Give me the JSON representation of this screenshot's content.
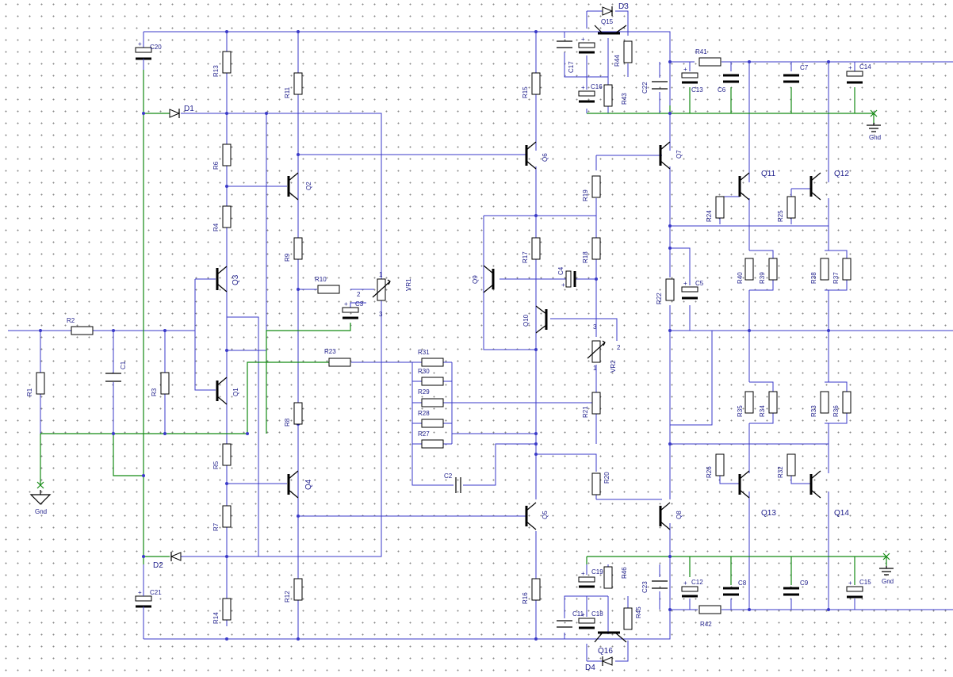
{
  "colors": {
    "wire": "#3a3ac8",
    "ground_rail": "#138a13",
    "component": "#000000",
    "label": "#1d1d8a",
    "grid_dot": "#8a8a8a"
  },
  "resistors": {
    "R1": "R1",
    "R2": "R2",
    "R3": "R3",
    "R4": "R4",
    "R5": "R5",
    "R6": "R6",
    "R7": "R7",
    "R8": "R8",
    "R9": "R9",
    "R10": "R10",
    "R11": "R11",
    "R12": "R12",
    "R13": "R13",
    "R14": "R14",
    "R15": "R15",
    "R16": "R16",
    "R17": "R17",
    "R18": "R18",
    "R19": "R19",
    "R20": "R20",
    "R21": "R21",
    "R22": "R22",
    "R23": "R23",
    "R24": "R24",
    "R25": "R25",
    "R26": "R26",
    "R27": "R27",
    "R28": "R28",
    "R29": "R29",
    "R30": "R30",
    "R31": "R31",
    "R32": "R32",
    "R33": "R33",
    "R34": "R34",
    "R35": "R35",
    "R36": "R36",
    "R37": "R37",
    "R38": "R38",
    "R39": "R39",
    "R40": "R40",
    "R41": "R41",
    "R42": "R42",
    "R43": "R43",
    "R44": "R44",
    "R45": "R45",
    "R46": "R46"
  },
  "capacitors": {
    "C1": "C1",
    "C2": "C2",
    "C3": "C3",
    "C4": "C4",
    "C5": "C5",
    "C6": "C6",
    "C7": "C7",
    "C8": "C8",
    "C9": "C9",
    "C11": "C11",
    "C12": "C12",
    "C13": "C13",
    "C14": "C14",
    "C15": "C15",
    "C16": "C16",
    "C17": "C17",
    "C18": "C18",
    "C19": "C19",
    "C20": "C20",
    "C21": "C21",
    "C22": "C22",
    "C23": "C23"
  },
  "transistors": {
    "Q1": "Q1",
    "Q2": "Q2",
    "Q3": "Q3",
    "Q4": "Q4",
    "Q5": "Q5",
    "Q6": "Q6",
    "Q7": "Q7",
    "Q8": "Q8",
    "Q9": "Q9",
    "Q10": "Q10",
    "Q11": "Q11",
    "Q12": "Q12",
    "Q13": "Q13",
    "Q14": "Q14",
    "Q15": "Q15",
    "Q16": "Q16"
  },
  "diodes": {
    "D1": "D1",
    "D2": "D2",
    "D3": "D3",
    "D4": "D4"
  },
  "pots": {
    "VR1": "VR1",
    "VR2": "VR2"
  },
  "pins": {
    "p1": "1",
    "p2": "2",
    "p3": "3"
  },
  "gnd": "Gnd",
  "plus": "+"
}
